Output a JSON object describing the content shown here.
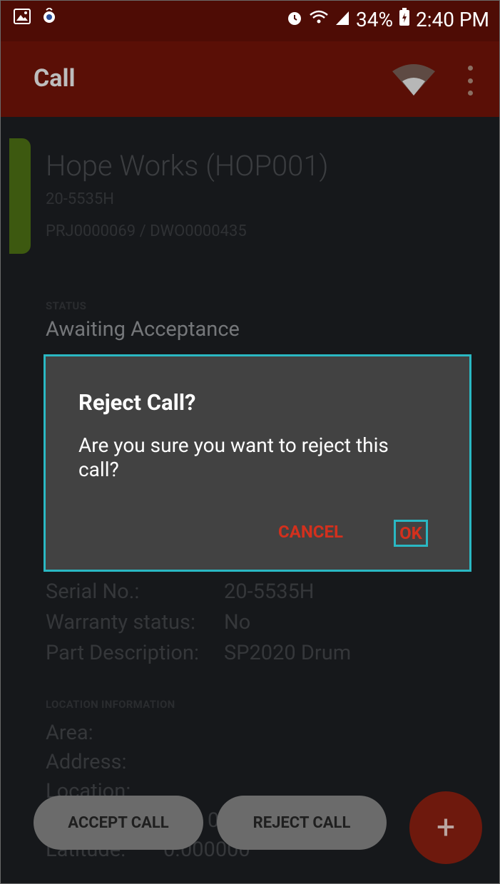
{
  "status_bar": {
    "battery": "34%",
    "time": "2:40 PM"
  },
  "toolbar": {
    "title": "Call"
  },
  "job": {
    "customer": "Hope Works (HOP001)",
    "serial": "20-5535H",
    "refs": "PRJ0000069 / DWO0000435"
  },
  "status": {
    "heading": "STATUS",
    "value": "Awaiting Acceptance"
  },
  "details": [
    {
      "label": "Serial No.:",
      "value": "20-5535H"
    },
    {
      "label": "Warranty status:",
      "value": "No"
    },
    {
      "label": "Part Description:",
      "value": "SP2020 Drum"
    }
  ],
  "location": {
    "heading": "LOCATION INFORMATION",
    "area_label": "Area:",
    "address_label": "Address:",
    "location_label": "Location:",
    "longitude_value_partial": "0",
    "latitude_label": "Latitude:",
    "latitude_value": "0.000000"
  },
  "actions": {
    "accept": "ACCEPT CALL",
    "reject": "REJECT CALL",
    "fab": "+"
  },
  "dialog": {
    "title": "Reject Call?",
    "message": "Are you sure you want to reject this call?",
    "cancel": "CANCEL",
    "ok": "OK"
  },
  "colors": {
    "status_bar": "#4e0c05",
    "toolbar": "#5a0f06",
    "dialog_bg": "#424242",
    "dialog_accent": "#d3301d",
    "highlight": "#2ab8c3"
  }
}
